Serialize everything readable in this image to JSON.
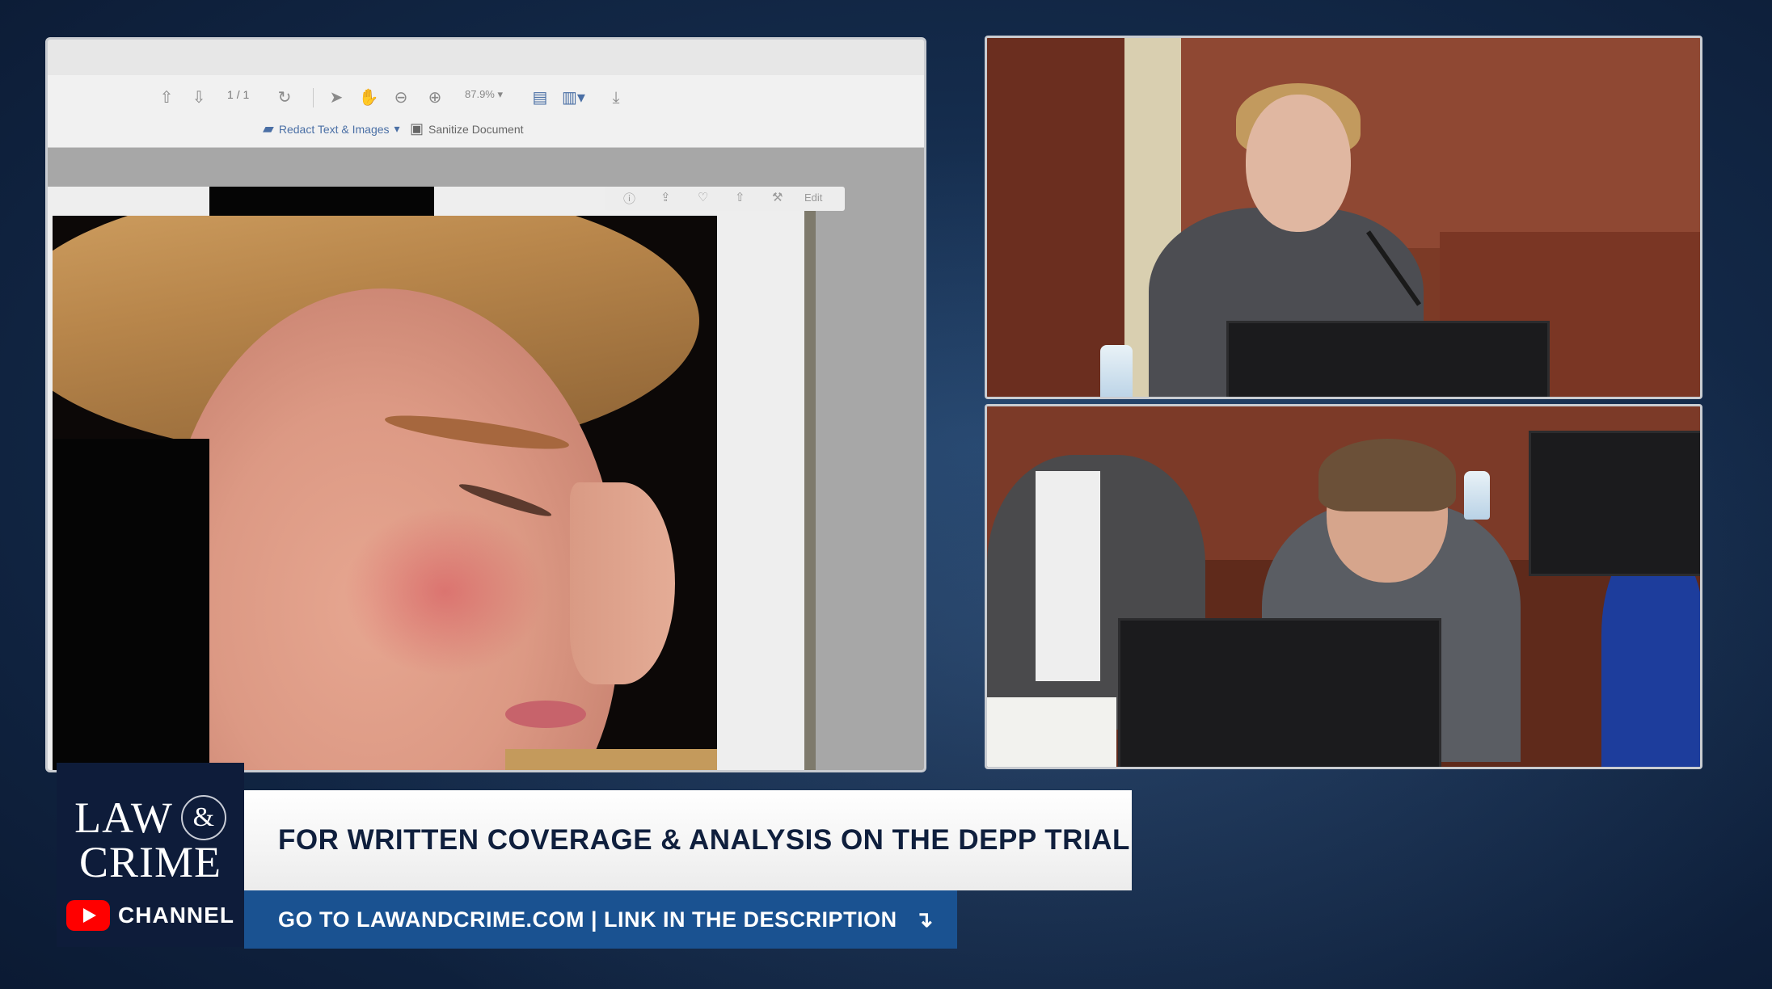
{
  "pdf_viewer": {
    "toolbar": {
      "page_current": "1",
      "page_total": "/ 1",
      "zoom": "87.9%",
      "redact_label": "Redact Text & Images",
      "sanitize_label": "Sanitize Document"
    },
    "page_toolbar": {
      "edit_label": "Edit"
    },
    "icons": [
      "up-arrow-icon",
      "down-arrow-icon",
      "rotate-icon",
      "select-arrow-icon",
      "hand-icon",
      "zoom-out-icon",
      "zoom-in-icon",
      "page-icon",
      "export-icon",
      "download-icon"
    ]
  },
  "branding": {
    "logo_line1": "LAW",
    "logo_amp": "&",
    "logo_line2": "CRIME",
    "logo_channel": "CHANNEL",
    "youtube_color": "#ff0000",
    "navy": "#0e1c3a",
    "blue": "#1a5291"
  },
  "banner": {
    "headline": "FOR WRITTEN COVERAGE & ANALYSIS ON THE DEPP TRIAL",
    "subline": "GO TO LAWANDCRIME.COM | LINK IN THE DESCRIPTION"
  }
}
